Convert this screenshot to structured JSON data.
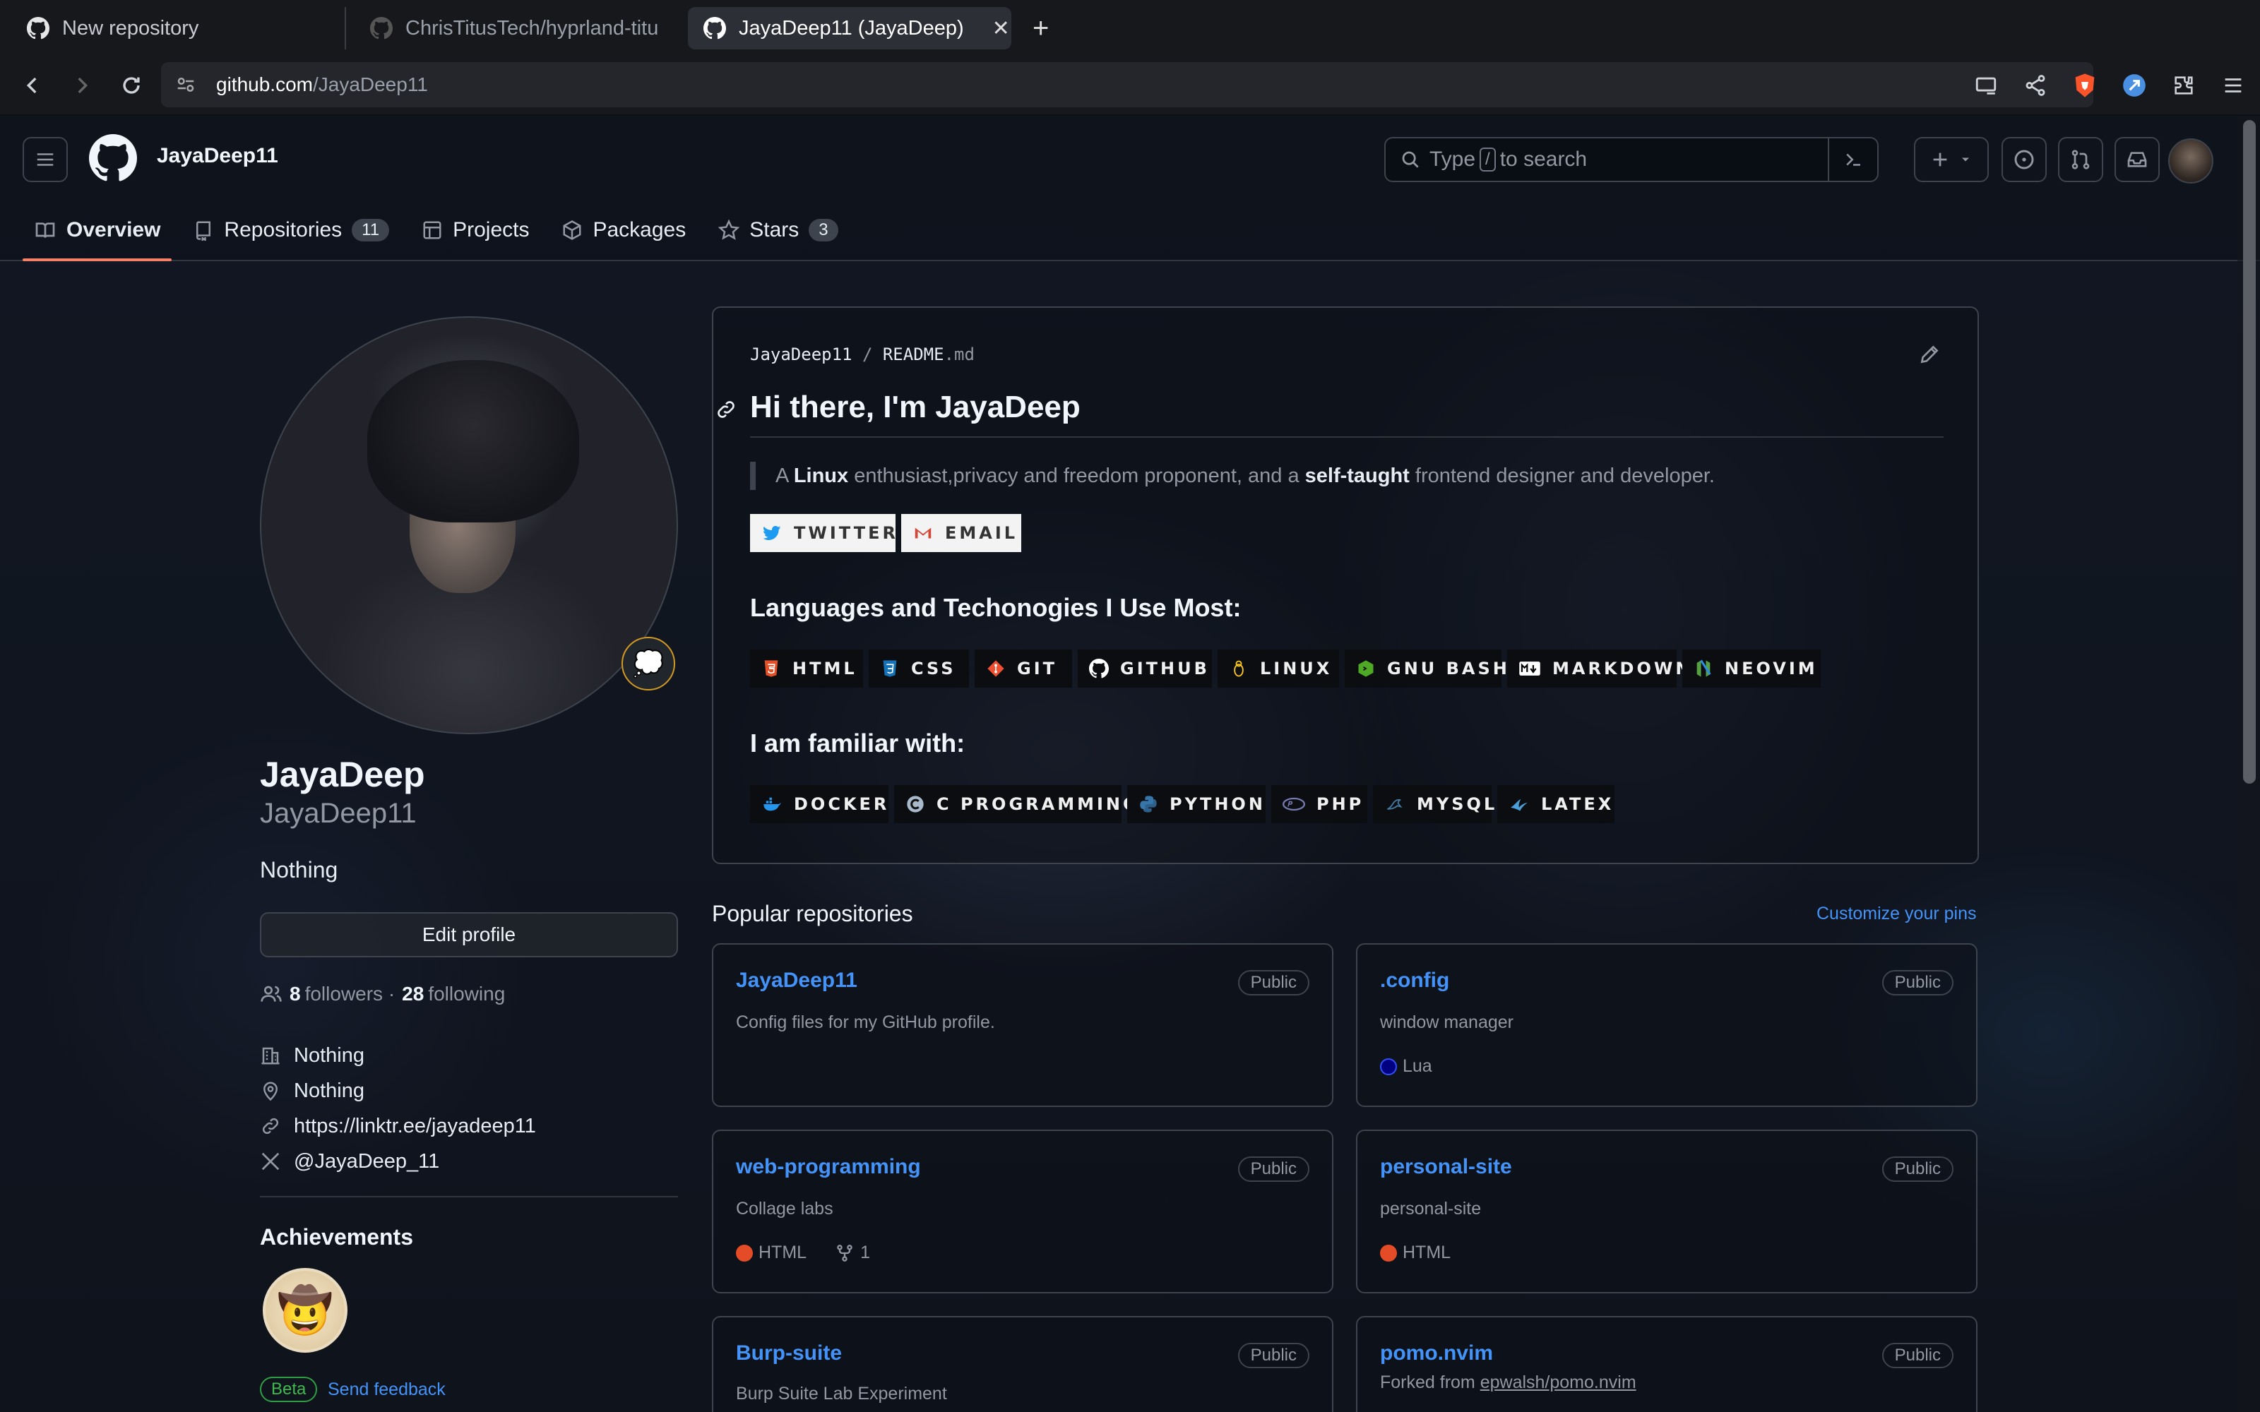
{
  "browser": {
    "tabs": [
      {
        "title": "New repository",
        "icon": "github-icon"
      },
      {
        "title": "ChrisTitusTech/hyprland-titu",
        "icon": "github-icon"
      },
      {
        "title": "JayaDeep11 (JayaDeep)",
        "icon": "github-icon",
        "active": true
      }
    ],
    "url_host": "github.com",
    "url_path": "/JayaDeep11"
  },
  "header": {
    "username": "JayaDeep11",
    "search_pre": "Type",
    "search_key": "/",
    "search_post": "to search",
    "nav": [
      {
        "label": "Overview",
        "icon": "book-icon"
      },
      {
        "label": "Repositories",
        "icon": "repo-icon",
        "count": "11"
      },
      {
        "label": "Projects",
        "icon": "table-icon"
      },
      {
        "label": "Packages",
        "icon": "package-icon"
      },
      {
        "label": "Stars",
        "icon": "star-icon",
        "count": "3"
      }
    ]
  },
  "profile": {
    "name": "JayaDeep",
    "login": "JayaDeep11",
    "bio": "Nothing",
    "edit_label": "Edit profile",
    "followers": "8",
    "followers_label": "followers",
    "following": "28",
    "following_label": "following",
    "company": "Nothing",
    "location": "Nothing",
    "website": "https://linktr.ee/jayadeep11",
    "social": "@JayaDeep_11",
    "achievements_title": "Achievements",
    "beta": "Beta",
    "feedback": "Send feedback"
  },
  "readme": {
    "owner": "JayaDeep11",
    "sep": "/",
    "file": "README",
    "ext": ".md",
    "heading": "Hi there, I'm JayaDeep",
    "quote_a": "A ",
    "quote_b": "Linux",
    "quote_c": " enthusiast,privacy and freedom proponent, and a ",
    "quote_d": "self-taught",
    "quote_e": " frontend designer and developer.",
    "contact_badges": [
      "TWITTER",
      "EMAIL"
    ],
    "h_languages": "Languages and Techonogies I Use Most:",
    "languages": [
      "HTML",
      "CSS",
      "GIT",
      "GITHUB",
      "LINUX",
      "GNU BASH",
      "MARKDOWN",
      "NEOVIM"
    ],
    "h_familiar": "I am familiar with:",
    "familiar": [
      "DOCKER",
      "C PROGRAMMING",
      "PYTHON",
      "PHP",
      "MYSQL",
      "LATEX"
    ]
  },
  "repos": {
    "title": "Popular repositories",
    "customize": "Customize your pins",
    "items": [
      {
        "name": "JayaDeep11",
        "visibility": "Public",
        "desc": "Config files for my GitHub profile.",
        "lang": "",
        "color": ""
      },
      {
        "name": ".config",
        "visibility": "Public",
        "desc": "window manager",
        "lang": "Lua",
        "color": "#000080"
      },
      {
        "name": "web-programming",
        "visibility": "Public",
        "desc": "Collage labs",
        "lang": "HTML",
        "color": "#e34c26",
        "forks": "1"
      },
      {
        "name": "personal-site",
        "visibility": "Public",
        "desc": "personal-site",
        "lang": "HTML",
        "color": "#e34c26"
      },
      {
        "name": "Burp-suite",
        "visibility": "Public",
        "desc": "Burp Suite Lab Experiment",
        "lang": "",
        "color": ""
      },
      {
        "name": "pomo.nvim",
        "visibility": "Public",
        "desc_pre": "Forked from ",
        "desc_link": "epwalsh/pomo.nvim",
        "lang": "",
        "color": ""
      }
    ]
  }
}
